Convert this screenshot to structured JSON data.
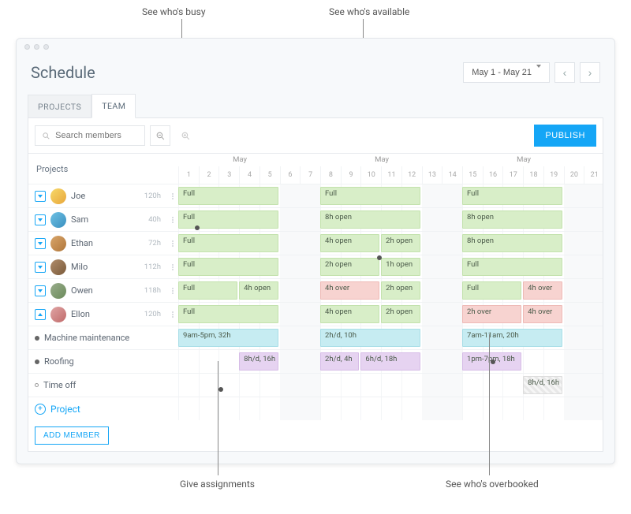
{
  "page_title": "Schedule",
  "date_range": "May 1 - May 21",
  "tabs": {
    "projects": "PROJECTS",
    "team": "TEAM"
  },
  "search_placeholder": "Search members",
  "publish_label": "PUBLISH",
  "grid_header_left": "Projects",
  "month_label": "May",
  "days": [
    "1",
    "2",
    "3",
    "4",
    "5",
    "6",
    "7",
    "8",
    "9",
    "10",
    "11",
    "12",
    "13",
    "14",
    "15",
    "16",
    "17",
    "18",
    "19",
    "20",
    "21"
  ],
  "members": [
    {
      "name": "Joe",
      "hours": "120h",
      "avatar_bg": "linear-gradient(135deg,#f7d96a,#e8a63a)"
    },
    {
      "name": "Sam",
      "hours": "40h",
      "avatar_bg": "linear-gradient(135deg,#6ec1e4,#3a8fbf)"
    },
    {
      "name": "Ethan",
      "hours": "72h",
      "avatar_bg": "linear-gradient(135deg,#d9a66b,#b0763a)"
    },
    {
      "name": "Milo",
      "hours": "112h",
      "avatar_bg": "linear-gradient(135deg,#b08c6b,#7a5a3a)"
    },
    {
      "name": "Owen",
      "hours": "118h",
      "avatar_bg": "linear-gradient(135deg,#9aad8c,#6a8a5a)"
    },
    {
      "name": "Ellon",
      "hours": "120h",
      "avatar_bg": "linear-gradient(135deg,#e0a5a5,#c06a6a)",
      "expanded": true
    }
  ],
  "lanes": {
    "joe": [
      {
        "s": 1,
        "e": 5,
        "color": "green",
        "label": "Full"
      },
      {
        "s": 8,
        "e": 12,
        "color": "green",
        "label": "Full"
      },
      {
        "s": 15,
        "e": 19,
        "color": "green",
        "label": "Full"
      }
    ],
    "sam": [
      {
        "s": 1,
        "e": 5,
        "color": "green",
        "label": "Full"
      },
      {
        "s": 8,
        "e": 12,
        "color": "green",
        "label": "8h open"
      },
      {
        "s": 15,
        "e": 19,
        "color": "green",
        "label": "8h open"
      }
    ],
    "ethan": [
      {
        "s": 1,
        "e": 5,
        "color": "green",
        "label": "Full"
      },
      {
        "s": 8,
        "e": 10,
        "color": "green",
        "label": "4h open"
      },
      {
        "s": 11,
        "e": 12,
        "color": "green",
        "label": "2h open"
      },
      {
        "s": 15,
        "e": 19,
        "color": "green",
        "label": "8h open"
      }
    ],
    "milo": [
      {
        "s": 1,
        "e": 5,
        "color": "green",
        "label": "Full"
      },
      {
        "s": 8,
        "e": 10,
        "color": "green",
        "label": "2h open"
      },
      {
        "s": 11,
        "e": 12,
        "color": "green",
        "label": "1h open"
      },
      {
        "s": 15,
        "e": 19,
        "color": "green",
        "label": "Full"
      }
    ],
    "owen": [
      {
        "s": 1,
        "e": 3,
        "color": "green",
        "label": "Full"
      },
      {
        "s": 4,
        "e": 5,
        "color": "green",
        "label": "4h open"
      },
      {
        "s": 8,
        "e": 10,
        "color": "red",
        "label": "4h over"
      },
      {
        "s": 11,
        "e": 12,
        "color": "green",
        "label": "2h open"
      },
      {
        "s": 15,
        "e": 17,
        "color": "green",
        "label": "Full"
      },
      {
        "s": 18,
        "e": 19,
        "color": "red",
        "label": "4h over"
      }
    ],
    "ellon": [
      {
        "s": 1,
        "e": 5,
        "color": "green",
        "label": "Full"
      },
      {
        "s": 8,
        "e": 10,
        "color": "green",
        "label": "4h open"
      },
      {
        "s": 11,
        "e": 12,
        "color": "green",
        "label": "2h open"
      },
      {
        "s": 15,
        "e": 17,
        "color": "red",
        "label": "2h over"
      },
      {
        "s": 18,
        "e": 19,
        "color": "red",
        "label": "4h over"
      }
    ],
    "machine": [
      {
        "s": 1,
        "e": 5,
        "color": "cyan",
        "label": "9am-5pm, 32h"
      },
      {
        "s": 8,
        "e": 12,
        "color": "cyan",
        "label": "2h/d, 10h"
      },
      {
        "s": 15,
        "e": 19,
        "color": "cyan",
        "label": "7am-11am, 20h"
      }
    ],
    "roofing": [
      {
        "s": 4,
        "e": 5,
        "color": "purple",
        "label": "8h/d, 16h"
      },
      {
        "s": 8,
        "e": 9,
        "color": "purple",
        "label": "2h/d, 4h"
      },
      {
        "s": 10,
        "e": 12,
        "color": "purple",
        "label": "6h/d, 18h"
      },
      {
        "s": 15,
        "e": 17,
        "color": "purple",
        "label": "1pm-7pm, 18h"
      }
    ],
    "timeoff": [
      {
        "s": 18,
        "e": 19,
        "color": "grey hatch",
        "label": "8h/d, 16h"
      }
    ]
  },
  "sub_projects": {
    "machine": "Machine maintenance",
    "roofing": "Roofing",
    "timeoff": "Time off",
    "add": "Project"
  },
  "add_member_label": "ADD MEMBER",
  "callouts": {
    "busy": "See who's busy",
    "available": "See who's available",
    "assignments": "Give assignments",
    "overbooked": "See who's overbooked"
  }
}
